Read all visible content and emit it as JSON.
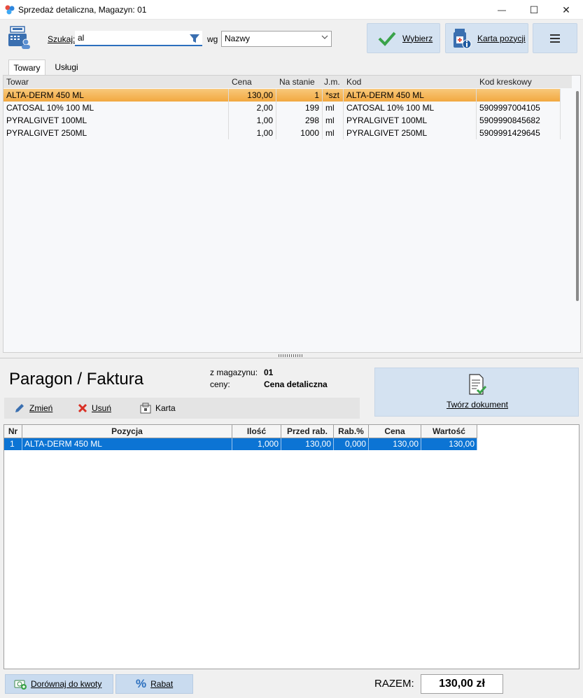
{
  "window": {
    "title": "Sprzedaż detaliczna, Magazyn: 01",
    "minimize": "—",
    "maximize": "☐",
    "close": "✕"
  },
  "toolbar": {
    "search_label": "Szukaj:",
    "search_value": "al",
    "wg_label": "wg",
    "wg_selected": "Nazwy",
    "wybierz_label": "Wybierz",
    "karta_pozycji_label": "Karta pozycji"
  },
  "tabs": [
    {
      "label": "Towary",
      "active": true
    },
    {
      "label": "Usługi",
      "active": false
    }
  ],
  "products": {
    "columns": [
      "Towar",
      "Cena",
      "Na stanie",
      "J.m.",
      "Kod",
      "Kod kreskowy"
    ],
    "rows": [
      {
        "towar": "ALTA-DERM  450 ML",
        "cena": "130,00",
        "stan": "1",
        "jm": "*szt",
        "kod": "ALTA-DERM  450 ML",
        "ean": "",
        "selected": true
      },
      {
        "towar": "CATOSAL 10% 100 ML",
        "cena": "2,00",
        "stan": "199",
        "jm": "ml",
        "kod": "CATOSAL 10% 100 ML",
        "ean": "5909997004105",
        "selected": false
      },
      {
        "towar": "PYRALGIVET 100ML",
        "cena": "1,00",
        "stan": "298",
        "jm": "ml",
        "kod": "PYRALGIVET 100ML",
        "ean": "5909990845682",
        "selected": false
      },
      {
        "towar": "PYRALGIVET 250ML",
        "cena": "1,00",
        "stan": "1000",
        "jm": "ml",
        "kod": "PYRALGIVET 250ML",
        "ean": "5909991429645",
        "selected": false
      }
    ]
  },
  "document": {
    "title": "Paragon / Faktura",
    "z_magazynu_label": "z magazynu:",
    "z_magazynu_value": "01",
    "ceny_label": "ceny:",
    "ceny_value": "Cena detaliczna",
    "create_label": "Twórz dokument",
    "actions": {
      "zmien": "Zmień",
      "usun": "Usuń",
      "karta": "Karta"
    }
  },
  "items": {
    "columns": [
      "Nr",
      "Pozycja",
      "Ilość",
      "Przed rab.",
      "Rab.%",
      "Cena",
      "Wartość"
    ],
    "rows": [
      {
        "nr": "1",
        "pozycja": "ALTA-DERM  450 ML",
        "ilosc": "1,000",
        "przed_rab": "130,00",
        "rab": "0,000",
        "cena": "130,00",
        "wartosc": "130,00"
      }
    ]
  },
  "footer": {
    "dorownaj_label": "Dorównaj do kwoty",
    "rabat_label": "Rabat",
    "razem_label": "RAZEM:",
    "razem_value": "130,00 zł"
  },
  "colors": {
    "accent": "#2b6fbe",
    "selected_row": "#f2a840",
    "selected_item": "#0c74d4",
    "button_bg": "#d4e2f1"
  }
}
